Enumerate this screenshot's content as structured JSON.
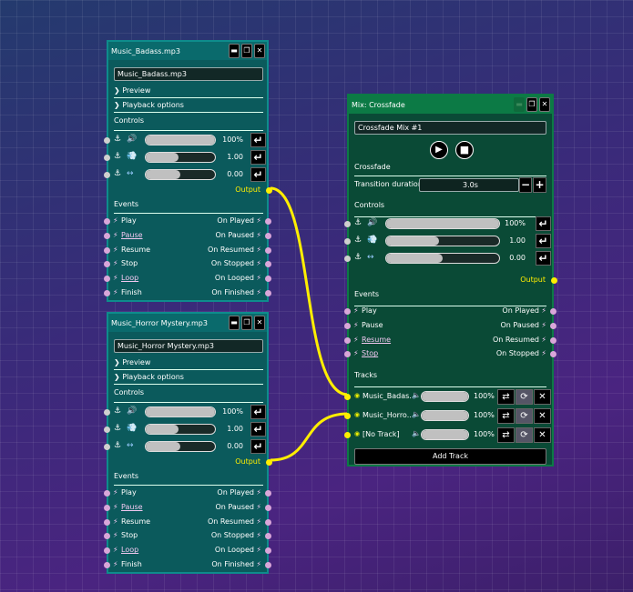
{
  "colors": {
    "wire": "#ffee00",
    "event_port": "#d9a6d9",
    "control_port": "#cfcfcf"
  },
  "nodes": [
    {
      "title": "Music_Badass.mp3",
      "file": "Music_Badass.mp3",
      "preview": "Preview",
      "playback_options": "Playback options",
      "controls_label": "Controls",
      "controls": [
        {
          "icon": "volume-icon",
          "value": "100%",
          "fill": 1.0
        },
        {
          "icon": "speed-icon",
          "value": "1.00",
          "fill": 0.47
        },
        {
          "icon": "pan-icon",
          "value": "0.00",
          "fill": 0.5
        }
      ],
      "output": "Output",
      "events_label": "Events",
      "events": [
        {
          "in": "Play",
          "out": "On Played",
          "u": false
        },
        {
          "in": "Pause",
          "out": "On Paused",
          "u": true
        },
        {
          "in": "Resume",
          "out": "On Resumed",
          "u": false
        },
        {
          "in": "Stop",
          "out": "On Stopped",
          "u": false
        },
        {
          "in": "Loop",
          "out": "On Looped",
          "u": true
        },
        {
          "in": "Finish",
          "out": "On Finished",
          "u": false
        }
      ]
    },
    {
      "title": "Music_Horror Mystery.mp3",
      "file": "Music_Horror Mystery.mp3",
      "preview": "Preview",
      "playback_options": "Playback options",
      "controls_label": "Controls",
      "controls": [
        {
          "icon": "volume-icon",
          "value": "100%",
          "fill": 1.0
        },
        {
          "icon": "speed-icon",
          "value": "1.00",
          "fill": 0.47
        },
        {
          "icon": "pan-icon",
          "value": "0.00",
          "fill": 0.5
        }
      ],
      "output": "Output",
      "events_label": "Events",
      "events": [
        {
          "in": "Play",
          "out": "On Played",
          "u": false
        },
        {
          "in": "Pause",
          "out": "On Paused",
          "u": true
        },
        {
          "in": "Resume",
          "out": "On Resumed",
          "u": false
        },
        {
          "in": "Stop",
          "out": "On Stopped",
          "u": false
        },
        {
          "in": "Loop",
          "out": "On Looped",
          "u": true
        },
        {
          "in": "Finish",
          "out": "On Finished",
          "u": false
        }
      ]
    }
  ],
  "mix": {
    "title": "Mix: Crossfade",
    "name": "Crossfade Mix #1",
    "crossfade_label": "Crossfade",
    "transition_label": "Transition duration:",
    "transition_value": "3.0s",
    "controls_label": "Controls",
    "controls": [
      {
        "icon": "volume-icon",
        "value": "100%",
        "fill": 1.0
      },
      {
        "icon": "speed-icon",
        "value": "1.00",
        "fill": 0.47
      },
      {
        "icon": "pan-icon",
        "value": "0.00",
        "fill": 0.5
      }
    ],
    "output": "Output",
    "events_label": "Events",
    "events": [
      {
        "in": "Play",
        "out": "On Played",
        "u": false
      },
      {
        "in": "Pause",
        "out": "On Paused",
        "u": false
      },
      {
        "in": "Resume",
        "out": "On Resumed",
        "u": true
      },
      {
        "in": "Stop",
        "out": "On Stopped",
        "u": true
      }
    ],
    "tracks_label": "Tracks",
    "tracks": [
      {
        "name": "Music_Badas...",
        "volume": "100%",
        "fill": 1.0
      },
      {
        "name": "Music_Horro...",
        "volume": "100%",
        "fill": 1.0
      },
      {
        "name": "[No Track]",
        "volume": "100%",
        "fill": 1.0
      }
    ],
    "add_track": "Add Track"
  }
}
